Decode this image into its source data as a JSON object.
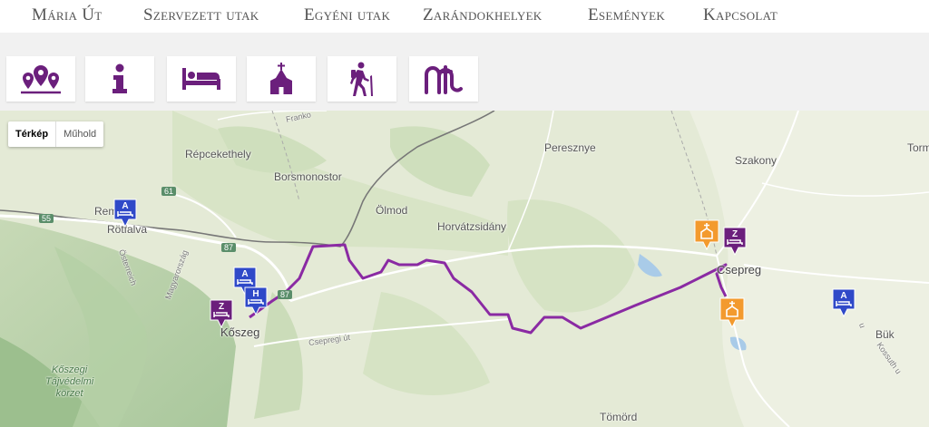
{
  "nav": {
    "items": [
      "Mária Út",
      "Szervezett utak",
      "Egyéni utak",
      "Zarándokhelyek",
      "Események",
      "Kapcsolat"
    ]
  },
  "toolbar": {
    "buttons": [
      {
        "icon": "map-pins-icon"
      },
      {
        "icon": "info-icon"
      },
      {
        "icon": "bed-icon"
      },
      {
        "icon": "church-icon"
      },
      {
        "icon": "hiker-icon"
      },
      {
        "icon": "maria-ut-logo-icon"
      }
    ],
    "accent_color": "#6b1f7c"
  },
  "map": {
    "type_control": {
      "map": "Térkép",
      "satellite": "Műhold"
    },
    "places": {
      "repcekethely": "Répcekethely",
      "borsmonostor": "Borsmonostor",
      "olmod": "Ölmod",
      "peresznye": "Peresznye",
      "horvatzsidany": "Horvátzsidány",
      "szakony": "Szakony",
      "torm": "Torm",
      "rem": "Rem",
      "rotfalva": "Rötfalva",
      "koszeg": "Kőszeg",
      "csepreg": "Csepreg",
      "buk": "Bük",
      "tomord": "Tömörd",
      "franko": "Franko",
      "osterreich": "Österreich",
      "magyarorszag": "Magyarország",
      "csepregi_ut": "Csepregi út",
      "kossuth_u": "Kossuth u",
      "nature_park": "Kőszegi\nTájvédelmi\nkörzet",
      "utca_u": "u"
    },
    "road_numbers": [
      "55",
      "61",
      "87",
      "87"
    ],
    "markers": [
      {
        "letter": "A",
        "kind": "accommodation",
        "color": "#2f49c8"
      },
      {
        "letter": "A",
        "kind": "accommodation",
        "color": "#2f49c8"
      },
      {
        "letter": "H",
        "kind": "accommodation",
        "color": "#2f49c8"
      },
      {
        "letter": "Z",
        "kind": "pilgrim-site",
        "color": "#6b1f7c"
      },
      {
        "letter": "Z",
        "kind": "pilgrim-site",
        "color": "#6b1f7c"
      },
      {
        "letter": "A",
        "kind": "accommodation",
        "color": "#2f49c8"
      },
      {
        "letter": "",
        "kind": "church",
        "color": "#f39a2e"
      },
      {
        "letter": "",
        "kind": "church",
        "color": "#f39a2e"
      }
    ],
    "route_color": "#8a2aa3"
  }
}
